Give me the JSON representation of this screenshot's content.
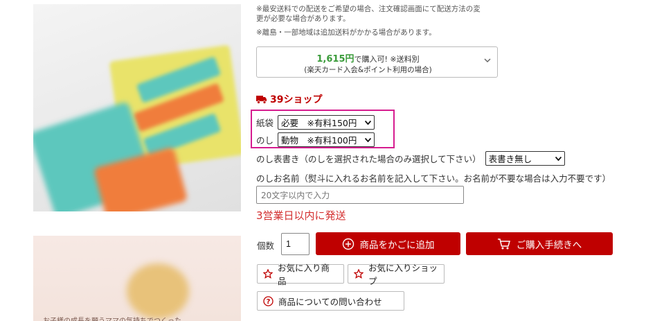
{
  "shipping_notes": {
    "line1": "※最安送料での配送をご希望の場合、注文確認画面にて配送方法の変",
    "line2": "更が必要な場合があります。",
    "line3": "※離島・一部地域は追加送料がかかる場合があります。"
  },
  "price_box": {
    "amount": "1,615円",
    "suffix": "で購入可! ※送料別",
    "condition": "(楽天カード入会&ポイント利用の場合)"
  },
  "shop39": {
    "label": "39ショップ",
    "color": "#bf0000"
  },
  "options": {
    "bag": {
      "label": "紙袋",
      "value": "必要　※有料150円"
    },
    "noshi": {
      "label": "のし",
      "value": "動物　※有料100円"
    },
    "noshi_title": {
      "label": "のし表書き（のしを選択された場合のみ選択して下さい）",
      "value": "表書き無し"
    },
    "noshi_name": {
      "label": "のしお名前（熨斗に入れるお名前を記入して下さい。お名前が不要な場合は入力不要です）",
      "placeholder": "20文字以内で入力"
    }
  },
  "shipping_time": "3営業日以内に発送",
  "quantity": {
    "label": "個数",
    "value": "1"
  },
  "buttons": {
    "add_to_cart": "商品をかごに追加",
    "checkout": "ご購入手続きへ",
    "fav_item": "お気に入り商品",
    "fav_shop": "お気に入りショップ",
    "inquiry": "商品についての問い合わせ"
  },
  "thumb_caption": "お子様の成長を願うママの気持ちでつくった",
  "colors": {
    "accent_red": "#bf0000",
    "price_green": "#3a9b3a",
    "highlight_magenta": "#d61c8f"
  }
}
